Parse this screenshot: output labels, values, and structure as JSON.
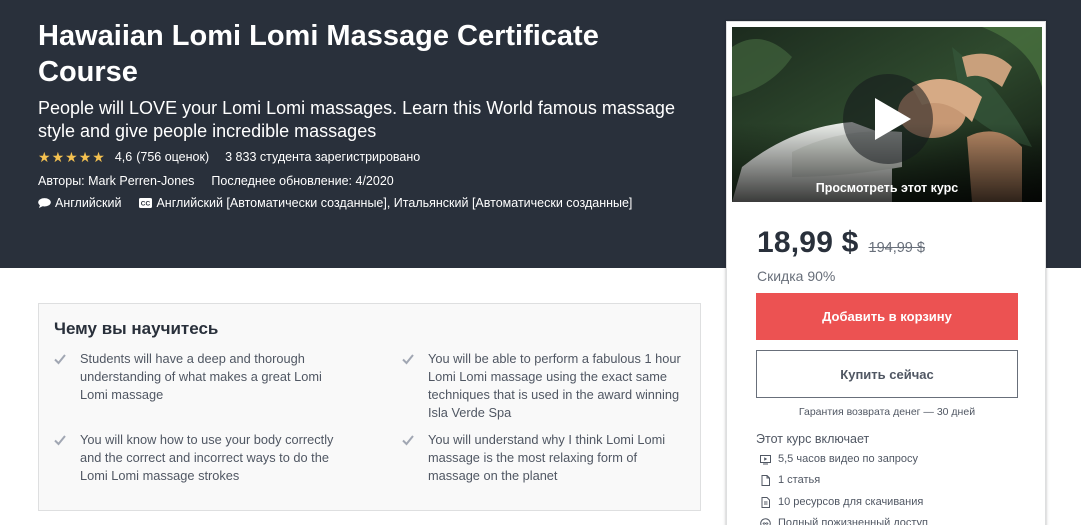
{
  "course": {
    "title": "Hawaiian Lomi Lomi Massage Certificate Course",
    "subtitle": "People will LOVE your Lomi Lomi massages. Learn this World famous massage style and give people incredible massages",
    "rating": "4,6",
    "rating_value": 4.6,
    "rating_count": "(756 оценок)",
    "students": "3 833 студента зарегистрировано",
    "authors": "Авторы: Mark Perren-Jones",
    "last_updated": "Последнее обновление: 4/2020",
    "language": "Английский",
    "captions": "Английский [Автоматически созданные], Итальянский [Автоматически созданные]"
  },
  "learn": {
    "title": "Чему вы научитесь",
    "items": [
      "Students will have a deep and thorough understanding of what makes a great Lomi Lomi massage",
      "You will be able to perform a fabulous 1 hour Lomi Lomi massage using the exact same techniques that is used in the award winning Isla Verde Spa",
      "You will know how to use your body correctly and the correct and incorrect ways to do the Lomi Lomi massage strokes",
      "You will understand why I think Lomi Lomi massage is the most relaxing form of massage on the planet"
    ]
  },
  "sidebar": {
    "preview_label": "Просмотреть этот курс",
    "price": "18,99 $",
    "old_price": "194,99 $",
    "discount": "Скидка 90%",
    "add_to_cart": "Добавить в корзину",
    "buy_now": "Купить сейчас",
    "guarantee": "Гарантия возврата денег — 30 дней",
    "includes_title": "Этот курс включает",
    "includes": [
      {
        "icon": "video-icon",
        "text": "5,5 часов видео по запросу"
      },
      {
        "icon": "article-icon",
        "text": "1 статья"
      },
      {
        "icon": "download-icon",
        "text": "10 ресурсов для скачивания"
      },
      {
        "icon": "infinity-icon",
        "text": "Полный пожизненный доступ"
      }
    ]
  },
  "colors": {
    "hero_bg": "#29303b",
    "star": "#f4c150",
    "cart_button": "#ec5252"
  }
}
